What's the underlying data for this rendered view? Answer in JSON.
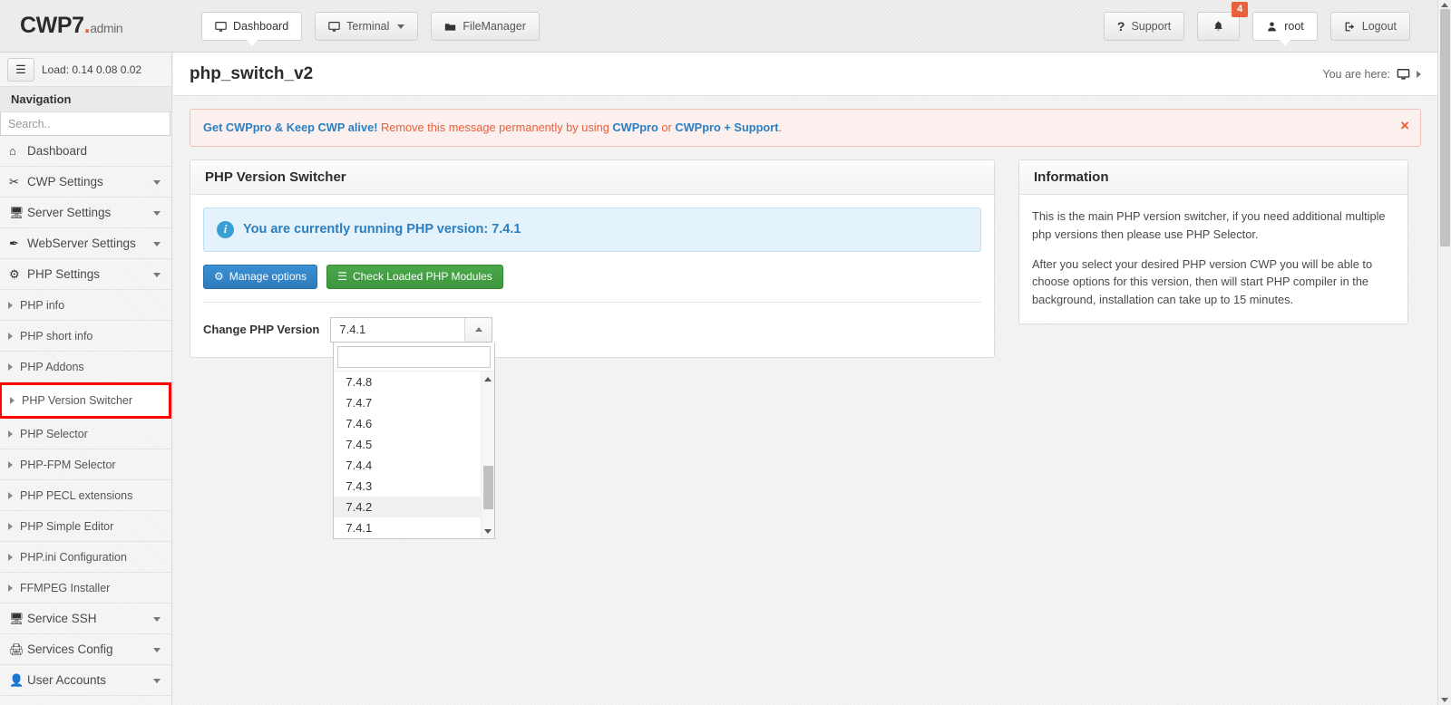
{
  "header": {
    "logo_main": "CWP7",
    "logo_dot": ".",
    "logo_admin": "admin",
    "nav": [
      {
        "label": "Dashboard",
        "icon": "monitor-icon",
        "active": true,
        "caret": false
      },
      {
        "label": "Terminal",
        "icon": "monitor-icon",
        "active": false,
        "caret": true
      },
      {
        "label": "FileManager",
        "icon": "folder-icon",
        "active": false,
        "caret": false
      }
    ],
    "support_label": "Support",
    "support_icon": "question-mark-icon",
    "bell_icon": "bell-icon",
    "bell_badge": "4",
    "user_label": "root",
    "user_icon": "user-icon",
    "logout_label": "Logout",
    "logout_icon": "logout-icon"
  },
  "sidebar": {
    "load_icon": "database-icon",
    "load_label": "Load: 0.14  0.08  0.02",
    "nav_header": "Navigation",
    "search_placeholder": "Search..",
    "search_value": "",
    "items": [
      {
        "label": "Dashboard",
        "icon": "home-icon",
        "caret": false,
        "sub": false
      },
      {
        "label": "CWP Settings",
        "icon": "tools-icon",
        "caret": true,
        "sub": false
      },
      {
        "label": "Server Settings",
        "icon": "server-icon",
        "caret": true,
        "sub": false
      },
      {
        "label": "WebServer Settings",
        "icon": "feather-icon",
        "caret": true,
        "sub": false
      },
      {
        "label": "PHP Settings",
        "icon": "gear-icon",
        "caret": true,
        "sub": false
      },
      {
        "label": "PHP info",
        "sub": true
      },
      {
        "label": "PHP short info",
        "sub": true
      },
      {
        "label": "PHP Addons",
        "sub": true
      },
      {
        "label": "PHP Version Switcher",
        "sub": true,
        "highlight": true
      },
      {
        "label": "PHP Selector",
        "sub": true
      },
      {
        "label": "PHP-FPM Selector",
        "sub": true
      },
      {
        "label": "PHP PECL extensions",
        "sub": true
      },
      {
        "label": "PHP Simple Editor",
        "sub": true
      },
      {
        "label": "PHP.ini Configuration",
        "sub": true
      },
      {
        "label": "FFMPEG Installer",
        "sub": true
      },
      {
        "label": "Service SSH",
        "icon": "monitor-icon",
        "caret": true,
        "sub": false
      },
      {
        "label": "Services Config",
        "icon": "services-icon",
        "caret": true,
        "sub": false
      },
      {
        "label": "User Accounts",
        "icon": "user-icon",
        "caret": true,
        "sub": false
      }
    ]
  },
  "page": {
    "title": "php_switch_v2",
    "breadcrumb_label": "You are here:",
    "breadcrumb_icon": "monitor-icon"
  },
  "alert": {
    "link1": "Get CWPpro & Keep CWP alive!",
    "text1": " Remove this message permanently by using ",
    "link2": "CWPpro",
    "text2": " or ",
    "link3": "CWPpro + Support",
    "text3": ".",
    "close_icon": "close-icon",
    "close_label": "×"
  },
  "switcher": {
    "panel_title": "PHP Version Switcher",
    "info_icon": "info-circle-icon",
    "info_text": "You are currently running PHP version: 7.4.1",
    "manage_button": "Manage options",
    "manage_icon": "gears-icon",
    "modules_button": "Check Loaded PHP Modules",
    "modules_icon": "list-icon",
    "field_label": "Change PHP Version",
    "selected_version": "7.4.1",
    "dropdown_open": true,
    "dropdown_search_value": "",
    "options": [
      "7.4.8",
      "7.4.7",
      "7.4.6",
      "7.4.5",
      "7.4.4",
      "7.4.3",
      "7.4.2",
      "7.4.1"
    ],
    "highlighted_option": "7.4.2"
  },
  "information": {
    "title": "Information",
    "paragraph1": "This is the main PHP version switcher, if you need additional multiple php versions then please use PHP Selector.",
    "paragraph2": "After you select your desired PHP version CWP you will be able to choose options for this version, then will start PHP compiler in the background, installation can take up to 15 minutes."
  },
  "colors": {
    "brand_orange": "#e8603c",
    "link_blue": "#2b7fc1",
    "info_blue": "#3a9fd4",
    "btn_blue": "#2f7cbd",
    "btn_green": "#4aa84a",
    "highlight_red": "#ff0000"
  }
}
